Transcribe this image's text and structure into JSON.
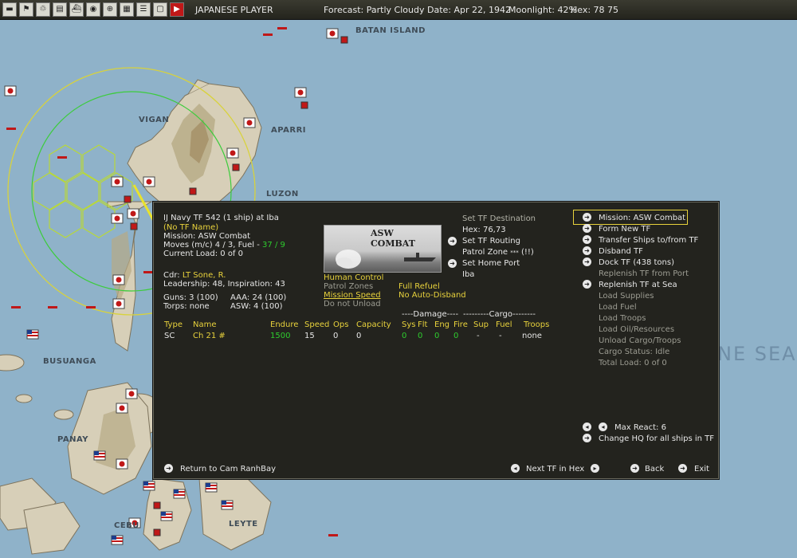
{
  "topbar": {
    "icons": [
      "save-icon",
      "flag-icon",
      "recycle-icon",
      "chart-icon",
      "ships-icon",
      "globe-icon",
      "target-icon",
      "ob-icon",
      "list-icon",
      "notepad-icon",
      "play-icon"
    ],
    "player": "JAPANESE PLAYER",
    "forecast": "Forecast: Partly Cloudy",
    "date": "Date: Apr 22, 1942",
    "moonlight": "Moonlight: 42%",
    "hex": "Hex: 78 75"
  },
  "map": {
    "labels": {
      "batan": "BATAN ISLAND",
      "vigan": "VIGAN",
      "aparri": "APARRI",
      "luzon": "LUZON",
      "busuanga": "BUSUANGA",
      "panay": "PANAY",
      "cebu": "CEBU",
      "leyte": "LEYTE",
      "sea": "NE SEA"
    }
  },
  "panel": {
    "tf_title": "IJ Navy TF 542 (1 ship) at Iba",
    "tf_name": "(No TF Name)",
    "mission": "Mission: ASW Combat",
    "moves": "Moves (m/c)  4 / 3, Fuel - ",
    "fuel": "37 / 9",
    "current_load": "Current Load: 0 of 0",
    "cdr_label": "Cdr:",
    "cdr_name": "LT Sone, R.",
    "leadership": "Leadership: 48, Inspiration: 43",
    "guns": "Guns: 3 (100)",
    "aaa": "AAA: 24 (100)",
    "torps": "Torps: none",
    "asw": "ASW: 4 (100)",
    "image_caption": "ASW COMBAT",
    "human_control": "Human Control",
    "patrol_zones": "Patrol Zones",
    "full_refuel": "Full Refuel",
    "mission_speed": "Mission Speed",
    "no_auto_disband": "No Auto-Disband",
    "do_not_unload": "Do not Unload",
    "set_tf_destination": "Set TF Destination",
    "hex_value": "Hex: 76,73",
    "set_tf_routing": "Set TF Routing",
    "patrol_zone": "Patrol Zone",
    "patrol_zone_suffix": "(!!)",
    "set_home_port": "Set Home Port",
    "home_port": "Iba",
    "damage_header": "----Damage----",
    "cargo_header": "---------Cargo--------",
    "columns": [
      "Type",
      "Name",
      "Endure",
      "Speed",
      "Ops",
      "Capacity",
      "Sys",
      "Flt",
      "Eng",
      "Fire",
      "Sup",
      "Fuel",
      "Troops"
    ],
    "ship": {
      "type": "SC",
      "name": "Ch 21 #",
      "endure": "1500",
      "speed": "15",
      "ops": "0",
      "capacity": "0",
      "sys": "0",
      "flt": "0",
      "eng": "0",
      "fire": "0",
      "sup": "-",
      "fuel": "-",
      "troops": "none"
    },
    "menu": [
      {
        "label": "Mission: ASW Combat",
        "enabled": true,
        "arrow": true
      },
      {
        "label": "Form New TF",
        "enabled": true,
        "arrow": true
      },
      {
        "label": "Transfer Ships to/from TF",
        "enabled": true,
        "arrow": true
      },
      {
        "label": "Disband TF",
        "enabled": true,
        "arrow": true
      },
      {
        "label": "Dock TF (438 tons)",
        "enabled": true,
        "arrow": true
      },
      {
        "label": "Replenish TF from Port",
        "enabled": false,
        "arrow": false
      },
      {
        "label": "Replenish TF at Sea",
        "enabled": true,
        "arrow": true
      },
      {
        "label": "Load Supplies",
        "enabled": false,
        "arrow": false
      },
      {
        "label": "Load Fuel",
        "enabled": false,
        "arrow": false
      },
      {
        "label": "Load Troops",
        "enabled": false,
        "arrow": false
      },
      {
        "label": "Load Oil/Resources",
        "enabled": false,
        "arrow": false
      },
      {
        "label": "Unload Cargo/Troops",
        "enabled": false,
        "arrow": false
      },
      {
        "label": "Cargo Status: Idle",
        "enabled": false,
        "arrow": false
      },
      {
        "label": "Total Load: 0 of 0",
        "enabled": false,
        "arrow": false
      }
    ],
    "max_react": "Max React:  6",
    "change_hq": "Change HQ for all ships in TF",
    "return": "Return to Cam RanhBay",
    "next_tf": "Next TF in Hex",
    "back": "Back",
    "exit": "Exit"
  }
}
